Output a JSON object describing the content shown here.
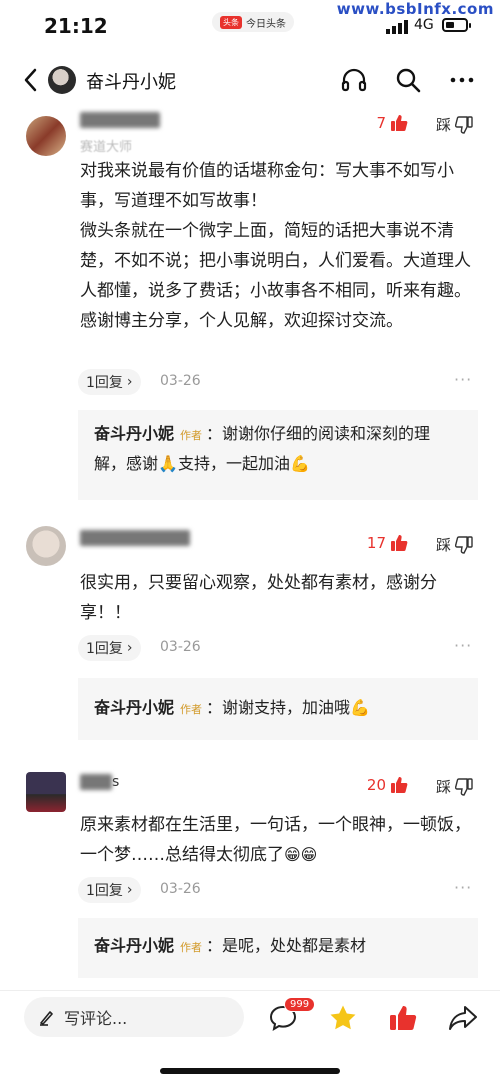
{
  "status_bar": {
    "time": "21:12",
    "app_logo": "头条",
    "app_name": "今日头条",
    "network": "4G"
  },
  "watermark": "www.bsbInfx.com",
  "nav": {
    "title": "奋斗丹小妮"
  },
  "comments": [
    {
      "user_tag": "赛道大师",
      "likes": "7",
      "dislike_label": "踩",
      "body": "对我来说最有价值的话堪称金句：写大事不如写小事，写道理不如写故事！\n微头条就在一个微字上面，简短的话把大事说不清楚，不如不说；把小事说明白，人们爱看。大道理人人都懂，说多了费话；小故事各不相同，听来有趣。感谢博主分享，个人见解，欢迎探讨交流。",
      "reply_count": "1回复",
      "date": "03-26",
      "reply": {
        "author": "奋斗丹小妮",
        "tag": "作者",
        "text_before": "：谢谢你仔细的阅读和深刻的理解，感谢",
        "text_mid": "支持，一起加油",
        "emoji1": "🙏",
        "emoji2": "💪"
      }
    },
    {
      "user_tag": "",
      "likes": "17",
      "dislike_label": "踩",
      "body": "很实用，只要留心观察，处处都有素材，感谢分享！！",
      "reply_count": "1回复",
      "date": "03-26",
      "reply": {
        "author": "奋斗丹小妮",
        "tag": "作者",
        "text_before": "：谢谢支持，加油哦",
        "emoji1": "💪"
      }
    },
    {
      "user_tag": "s",
      "likes": "20",
      "dislike_label": "踩",
      "body": "原来素材都在生活里，一句话，一个眼神，一顿饭，一个梦……总结得太彻底了",
      "emoji": "😁😁",
      "reply_count": "1回复",
      "date": "03-26",
      "reply": {
        "author": "奋斗丹小妮",
        "tag": "作者",
        "text_before": "：是呢，处处都是素材"
      }
    }
  ],
  "bottom_bar": {
    "input_placeholder": "写评论...",
    "comment_badge": "999"
  },
  "colors": {
    "accent_red": "#e8322d",
    "author_tag": "#d29a2a",
    "watermark_blue": "#2a4fc4"
  },
  "icons": [
    "back-icon",
    "headphones-icon",
    "search-icon",
    "more-icon",
    "thumbs-up-icon",
    "thumbs-down-icon",
    "pen-icon",
    "comment-icon",
    "star-icon",
    "share-icon"
  ]
}
